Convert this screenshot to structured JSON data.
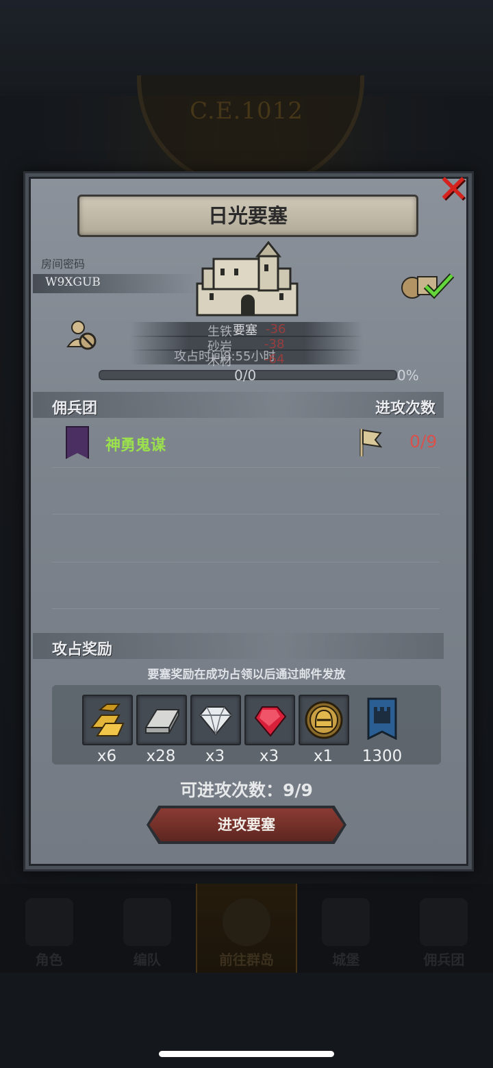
{
  "background": {
    "era": "C.E.1012"
  },
  "dialog": {
    "title": "日光要塞",
    "room_code_label": "房间密码",
    "room_code": "W9XGUB",
    "overlay": {
      "line1_label": "生铁",
      "line1_value": "-36",
      "line1_fort": "要塞",
      "line2_label": "砂岩",
      "line2_value": "-38",
      "line3_label": "木材",
      "line3_value": "-64",
      "time_text": "攻占时间8:55小时"
    },
    "progress": {
      "value_text": "0/0",
      "percent_text": "0%",
      "percent": 0
    },
    "mercenary_header": "佣兵团",
    "attack_count_header": "进攻次数",
    "guild": {
      "name": "神勇鬼谋",
      "attacks": "0/9"
    },
    "rewards_header": "攻占奖励",
    "rewards_note": "要塞奖励在成功占领以后通过邮件发放",
    "rewards": [
      {
        "icon": "gold-bar-icon",
        "qty": "x6"
      },
      {
        "icon": "iron-bar-icon",
        "qty": "x28"
      },
      {
        "icon": "diamond-icon",
        "qty": "x3"
      },
      {
        "icon": "ruby-icon",
        "qty": "x3"
      },
      {
        "icon": "helmet-medal-icon",
        "qty": "x1"
      },
      {
        "icon": "fortress-banner-icon",
        "qty": "1300"
      }
    ],
    "attempts_text": "可进攻次数：9/9",
    "attack_button": "进攻要塞"
  },
  "bottom_nav": {
    "items": [
      {
        "label": "角色"
      },
      {
        "label": "编队"
      },
      {
        "label": "前往群岛"
      },
      {
        "label": "城堡"
      },
      {
        "label": "佣兵团"
      }
    ]
  },
  "colors": {
    "guild_name": "#9be04d",
    "attack_count": "#d8514c",
    "button": "#7a332c"
  }
}
